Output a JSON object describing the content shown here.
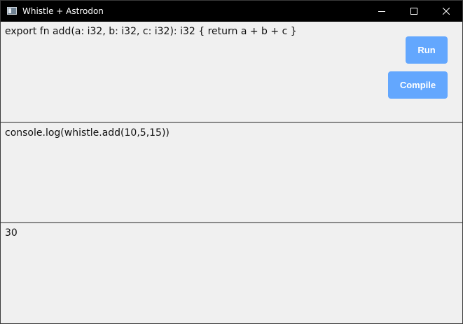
{
  "window": {
    "title": "Whistle + Astrodon"
  },
  "editor": {
    "code": "export fn add(a: i32, b: i32, c: i32): i32 { return a + b + c }"
  },
  "actions": {
    "run_label": "Run",
    "compile_label": "Compile"
  },
  "script": {
    "code": "console.log(whistle.add(10,5,15))"
  },
  "output": {
    "text": "30"
  },
  "colors": {
    "titlebar": "#000000",
    "pane_background": "#f0f0f0",
    "button_accent": "#63a7fe",
    "divider": "#8a8a8a"
  },
  "icons": {
    "app": "window-app-icon",
    "minimize": "minimize-icon",
    "maximize": "maximize-icon",
    "close": "close-icon"
  }
}
